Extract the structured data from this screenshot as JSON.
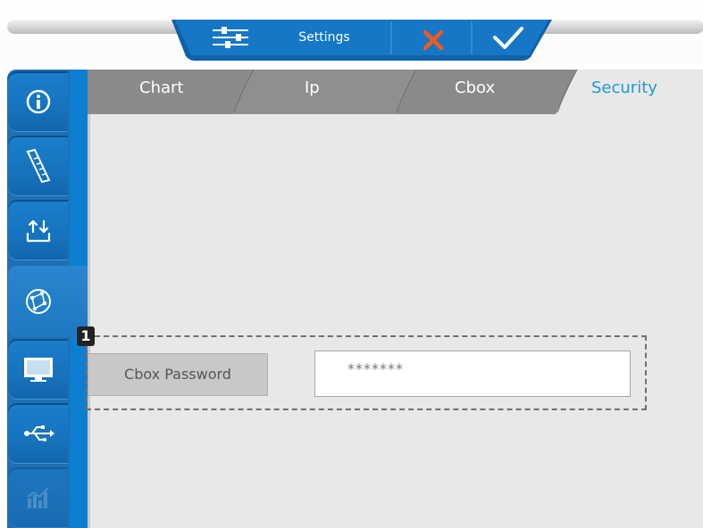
{
  "toolbar": {
    "title": "Settings",
    "icons": [
      "sliders-icon",
      "close-icon",
      "check-icon"
    ],
    "colors": {
      "blue": "#1673bd",
      "cancel": "#f15a22",
      "white": "#ffffff"
    }
  },
  "sidebar": {
    "items": [
      {
        "name": "info",
        "icon": "info-icon",
        "active": false
      },
      {
        "name": "ruler",
        "icon": "ruler-icon",
        "active": false
      },
      {
        "name": "upload-download",
        "icon": "upload-download-icon",
        "active": false
      },
      {
        "name": "network",
        "icon": "network-icon",
        "active": true
      },
      {
        "name": "display",
        "icon": "monitor-icon",
        "active": false
      },
      {
        "name": "usb",
        "icon": "usb-icon",
        "active": false
      },
      {
        "name": "stats",
        "icon": "chart-icon",
        "active": false,
        "disabled": true
      }
    ]
  },
  "tabs": [
    {
      "label": "Chart",
      "active": false
    },
    {
      "label": "Ip",
      "active": false
    },
    {
      "label": "Cbox",
      "active": false
    },
    {
      "label": "Security",
      "active": true
    }
  ],
  "security": {
    "marker": "1",
    "password_label": "Cbox Password",
    "password_value": "*******"
  }
}
